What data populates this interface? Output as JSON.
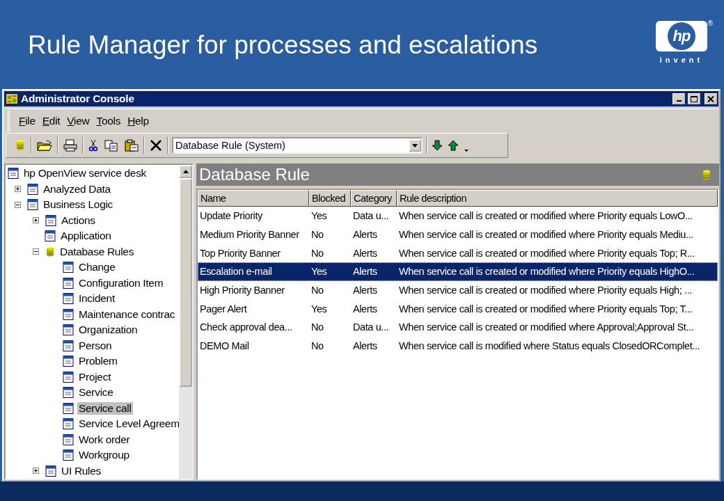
{
  "slide": {
    "title": "Rule Manager for processes and escalations",
    "logo": {
      "mark": "hp",
      "registered": "®",
      "tagline": "invent"
    }
  },
  "window": {
    "title": "Administrator Console"
  },
  "menu": [
    {
      "label": "File"
    },
    {
      "label": "Edit"
    },
    {
      "label": "View"
    },
    {
      "label": "Tools"
    },
    {
      "label": "Help"
    }
  ],
  "toolbar": {
    "combo_value": "Database Rule (System)"
  },
  "tree": [
    {
      "label": "hp OpenView service desk",
      "selected": false,
      "children": [
        {
          "label": "Analyzed Data",
          "selected": false,
          "expanded": false
        },
        {
          "label": "Business Logic",
          "selected": false,
          "expanded": true,
          "children": [
            {
              "label": "Actions",
              "selected": false,
              "expanded": false
            },
            {
              "label": "Application",
              "selected": false
            },
            {
              "label": "Database Rules",
              "selected": false,
              "expanded": true,
              "children": [
                {
                  "label": "Change",
                  "selected": false
                },
                {
                  "label": "Configuration Item",
                  "selected": false
                },
                {
                  "label": "Incident",
                  "selected": false
                },
                {
                  "label": "Maintenance contrac",
                  "selected": false
                },
                {
                  "label": "Organization",
                  "selected": false
                },
                {
                  "label": "Person",
                  "selected": false
                },
                {
                  "label": "Problem",
                  "selected": false
                },
                {
                  "label": "Project",
                  "selected": false
                },
                {
                  "label": "Service",
                  "selected": false
                },
                {
                  "label": "Service call",
                  "selected": true
                },
                {
                  "label": "Service Level Agreem",
                  "selected": false
                },
                {
                  "label": "Work order",
                  "selected": false
                },
                {
                  "label": "Workgroup",
                  "selected": false
                }
              ]
            },
            {
              "label": "UI Rules",
              "selected": false,
              "expanded": false
            }
          ]
        }
      ]
    }
  ],
  "panel": {
    "title": "Database Rule"
  },
  "table": {
    "columns": [
      "Name",
      "Blocked",
      "Category",
      "Rule description"
    ],
    "rows": [
      {
        "cells": [
          "Update Priority",
          "Yes",
          "Data u...",
          "When service call is created or modified where Priority equals LowO..."
        ],
        "selected": false
      },
      {
        "cells": [
          "Medium Priority Banner",
          "No",
          "Alerts",
          "When service call is created or modified where Priority equals Mediu..."
        ],
        "selected": false
      },
      {
        "cells": [
          "Top Priority Banner",
          "No",
          "Alerts",
          "When service call is created or modified where Priority equals Top; R..."
        ],
        "selected": false
      },
      {
        "cells": [
          "Escalation e-mail",
          "Yes",
          "Alerts",
          "When service call is created or modified where Priority equals HighO..."
        ],
        "selected": true
      },
      {
        "cells": [
          "High Priority Banner",
          "No",
          "Alerts",
          "When service call is created or modified where Priority equals High; ..."
        ],
        "selected": false
      },
      {
        "cells": [
          "Pager Alert",
          "Yes",
          "Alerts",
          "When service call is created or modified where Priority equals Top; T..."
        ],
        "selected": false
      },
      {
        "cells": [
          "Check approval dea...",
          "No",
          "Data u...",
          "When service call is created or modified where Approval;Approval St..."
        ],
        "selected": false
      },
      {
        "cells": [
          "DEMO Mail",
          "No",
          "Alerts",
          "When service call is modified where Status equals ClosedORComplet..."
        ],
        "selected": false
      }
    ]
  }
}
